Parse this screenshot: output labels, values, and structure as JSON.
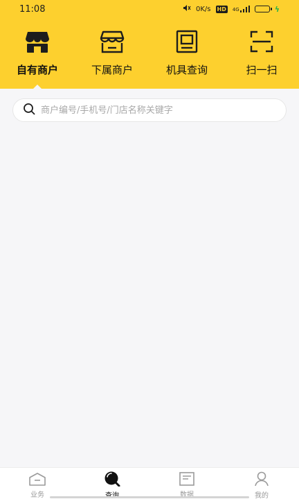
{
  "status_bar": {
    "time": "11:08",
    "network_speed": "0K/s",
    "hd_label": "HD",
    "signal_label": "4G",
    "charging_glyph": "ϟ",
    "icons": [
      "mute-icon",
      "hd-icon",
      "signal-icon",
      "battery-icon",
      "charging-icon"
    ]
  },
  "header": {
    "background_color": "#fdd02e",
    "actions": [
      {
        "label": "自有商户",
        "icon": "shop-icon",
        "active": true
      },
      {
        "label": "下属商户",
        "icon": "sub-shop-icon",
        "active": false
      },
      {
        "label": "机具查询",
        "icon": "device-icon",
        "active": false
      },
      {
        "label": "扫一扫",
        "icon": "scan-icon",
        "active": false
      }
    ]
  },
  "search": {
    "placeholder": "商户编号/手机号/门店名称关键字",
    "value": "",
    "icon": "search-icon"
  },
  "tabbar": {
    "items": [
      {
        "label": "业务",
        "icon": "business-icon",
        "active": false
      },
      {
        "label": "查询",
        "icon": "query-icon",
        "active": true
      },
      {
        "label": "数据",
        "icon": "data-icon",
        "active": false
      },
      {
        "label": "我的",
        "icon": "profile-icon",
        "active": false
      }
    ]
  }
}
